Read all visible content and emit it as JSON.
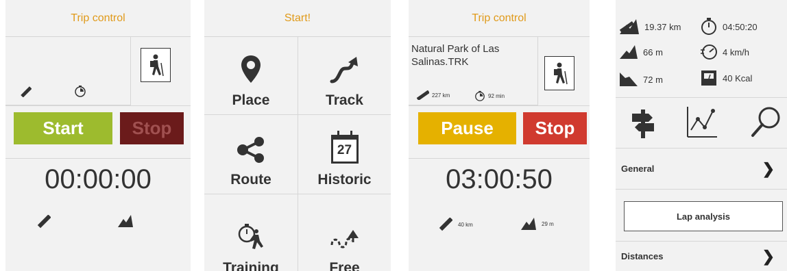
{
  "screen1": {
    "header": "Trip control",
    "start_label": "Start",
    "stop_label": "Stop",
    "timer": "00:00:00",
    "colors": {
      "start": "#9dbb2e",
      "stop": "#6b1b1b",
      "stop_text": "#a05050"
    }
  },
  "screen2": {
    "header": "Start!",
    "tiles": [
      {
        "label": "Place",
        "icon": "place-pin-icon"
      },
      {
        "label": "Track",
        "icon": "track-arrow-icon"
      },
      {
        "label": "Route",
        "icon": "route-share-icon"
      },
      {
        "label": "Historic",
        "icon": "calendar-icon",
        "day": "27"
      },
      {
        "label": "Training",
        "icon": "stopwatch-runner-icon"
      },
      {
        "label": "Free",
        "icon": "free-path-icon"
      }
    ]
  },
  "screen3": {
    "header": "Trip control",
    "track_name": "Natural Park of Las Salinas.TRK",
    "distance": "227 km",
    "duration": "92 min",
    "pause_label": "Pause",
    "stop_label": "Stop",
    "timer": "03:00:50",
    "trip_distance": "40 km",
    "trip_elevation": "29 m",
    "colors": {
      "pause": "#e5b100",
      "stop": "#d03a2f"
    }
  },
  "screen4": {
    "stats": [
      {
        "icon": "distance-mountain-icon",
        "value": "19.37 km"
      },
      {
        "icon": "stopwatch-icon",
        "value": "04:50:20"
      },
      {
        "icon": "ascent-icon",
        "value": "66 m"
      },
      {
        "icon": "speed-icon",
        "value": "4 km/h"
      },
      {
        "icon": "descent-icon",
        "value": "72 m"
      },
      {
        "icon": "scale-icon",
        "value": "40 Kcal"
      }
    ],
    "general_label": "General",
    "lap_label": "Lap analysis",
    "distances_label": "Distances"
  }
}
